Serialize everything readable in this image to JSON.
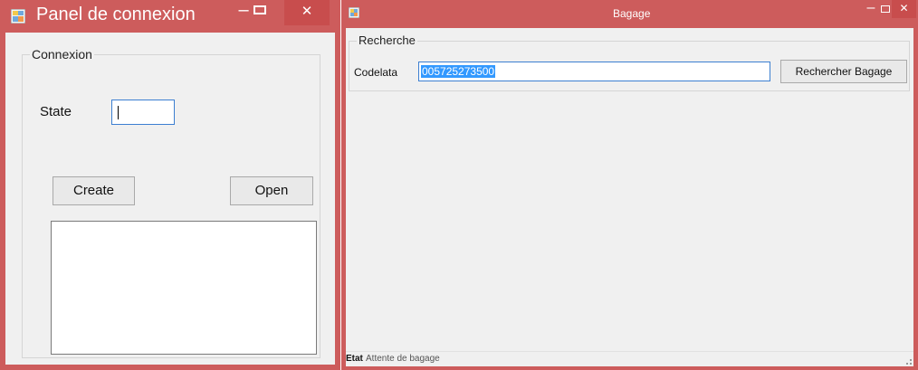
{
  "window_left": {
    "title": "Panel de connexion",
    "controls": {
      "minimize": "–",
      "close": "✕"
    },
    "groupbox_title": "Connexion",
    "state_label": "State",
    "state_value": "",
    "buttons": {
      "create": "Create",
      "open": "Open"
    },
    "colors": {
      "titlebar": "#cd5c5c",
      "client": "#f0f0f0"
    },
    "icons": {
      "app": "app-icon"
    }
  },
  "window_right": {
    "title": "Bagage",
    "controls": {
      "minimize": "–",
      "close": "✕"
    },
    "groupbox_title": "Recherche",
    "code_label": "Codelata",
    "code_value": "005725273500",
    "search_button": "Rechercher Bagage",
    "status": {
      "key": "Etat",
      "value": "Attente de bagage"
    },
    "colors": {
      "titlebar": "#cd5c5c",
      "selection": "#3399ff"
    },
    "icons": {
      "app": "app-icon"
    }
  }
}
